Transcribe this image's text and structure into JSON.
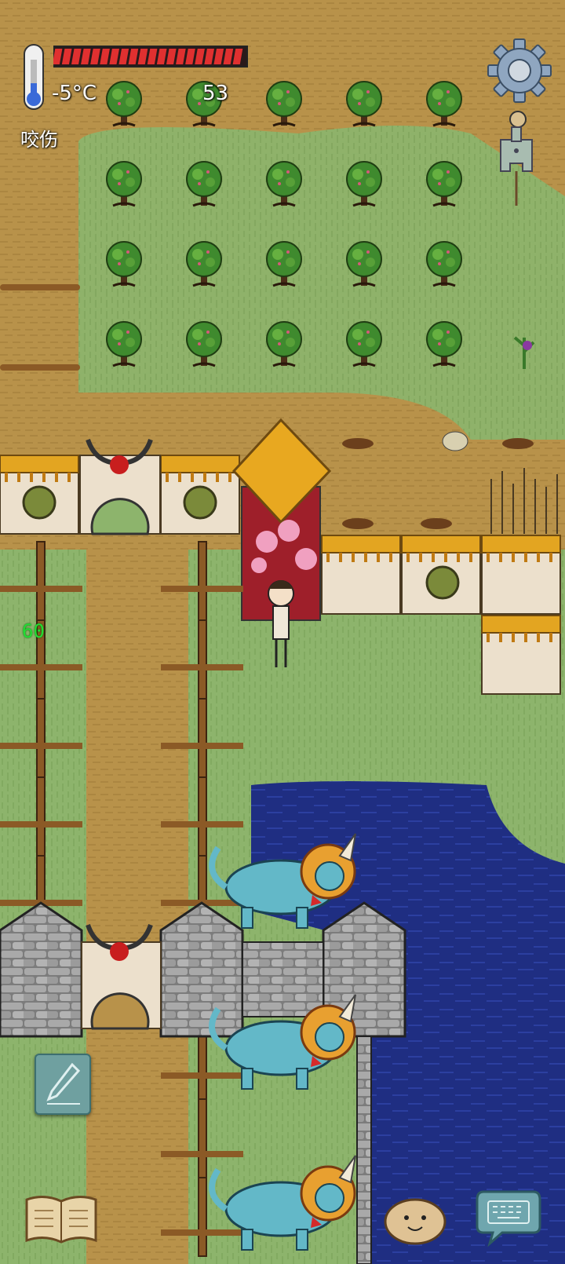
{
  "hud": {
    "temperature": "-5°C",
    "food": "53",
    "status": "咬伤",
    "health_segments": 20,
    "health_fill": 1.0
  },
  "world": {
    "floating_number": "60"
  },
  "icons": {
    "thermometer": "thermometer-icon",
    "settings": "gear-icon",
    "coin": "spade-coin-icon",
    "pencil": "pencil-icon",
    "book": "open-book-icon",
    "emote": "potato-face-icon",
    "keyboard": "keyboard-chat-icon"
  },
  "colors": {
    "health": "#e03030",
    "water": "#1d2d7a",
    "grass": "#8fb46a",
    "dirt": "#b8924a"
  }
}
